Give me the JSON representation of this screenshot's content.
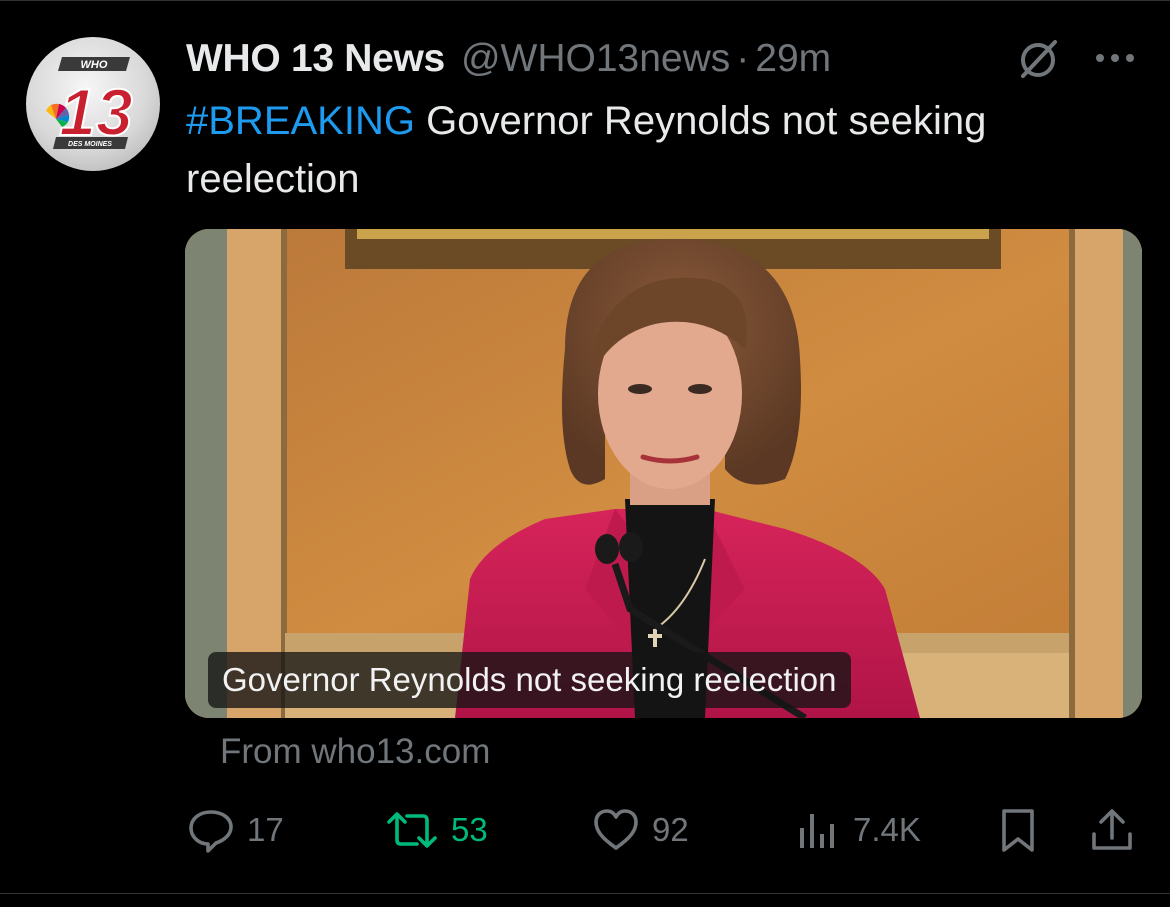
{
  "author": {
    "display_name": "WHO 13 News",
    "handle": "@WHO13news",
    "separator": "·",
    "time_ago": "29m",
    "avatar_logo": {
      "top_text": "WHO",
      "number": "13",
      "bottom_text": "DES MOINES"
    }
  },
  "tweet": {
    "hashtag": "#BREAKING",
    "text": " Governor Reynolds not seeking reelection"
  },
  "media": {
    "caption": "Governor Reynolds not seeking reelection",
    "source": "From who13.com"
  },
  "actions": {
    "replies": "17",
    "reposts": "53",
    "likes": "92",
    "views": "7.4K"
  },
  "colors": {
    "background": "#000000",
    "text": "#e7e9ea",
    "muted": "#71767b",
    "link": "#1d9bf0",
    "repost_active": "#00ba7c"
  },
  "icons": [
    "grok-icon",
    "more-icon",
    "reply-icon",
    "repost-icon",
    "like-icon",
    "views-icon",
    "bookmark-icon",
    "share-icon"
  ]
}
